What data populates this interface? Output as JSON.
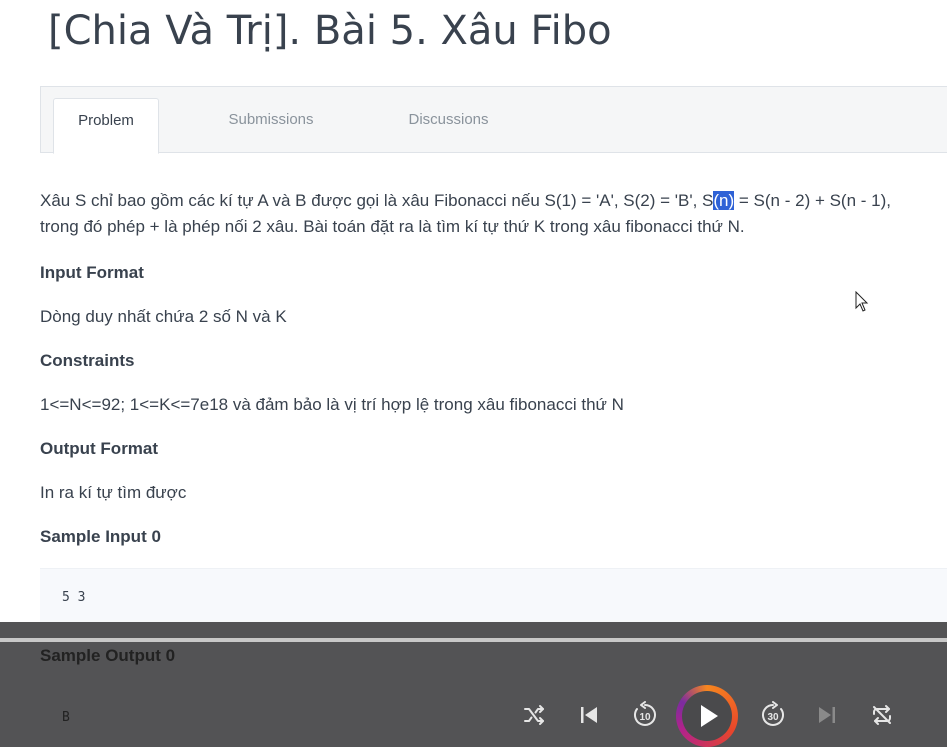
{
  "page": {
    "title": "[Chia Và Trị]. Bài 5. Xâu Fibo"
  },
  "tabs": [
    {
      "label": "Problem",
      "active": true
    },
    {
      "label": "Submissions",
      "active": false
    },
    {
      "label": "Discussions",
      "active": false
    }
  ],
  "statement": {
    "line1_before": "Xâu S chỉ bao gồm các kí tự A và B được gọi là xâu Fibonacci nếu S(1) = 'A', S(2) = 'B', S",
    "line1_highlight": "(n)",
    "line1_after": " = S(n - 2) + S(n - 1),",
    "line2": "trong đó phép + là phép nối 2 xâu. Bài toán đặt ra là tìm kí tự thứ K trong xâu fibonacci thứ N."
  },
  "sections": {
    "input_format_heading": "Input Format",
    "input_format_text": "Dòng duy nhất chứa 2 số N và K",
    "constraints_heading": "Constraints",
    "constraints_text": "1<=N<=92; 1<=K<=7e18 và đảm bảo là vị trí hợp lệ trong xâu fibonacci thứ N",
    "output_format_heading": "Output Format",
    "output_format_text": "In ra kí tự tìm được",
    "sample_input_heading": "Sample Input 0",
    "sample_input_code": "5 3",
    "sample_output_heading": "Sample Output 0",
    "sample_output_code": "B"
  },
  "player": {
    "controls": [
      "shuffle-icon",
      "previous-icon",
      "rewind-10-icon",
      "play-icon",
      "forward-30-icon",
      "next-icon",
      "repeat-icon"
    ],
    "rewind_seconds": "10",
    "forward_seconds": "30",
    "accent_colors": [
      "#f6861f",
      "#e8462b",
      "#b2238a",
      "#7b2ca0"
    ]
  }
}
